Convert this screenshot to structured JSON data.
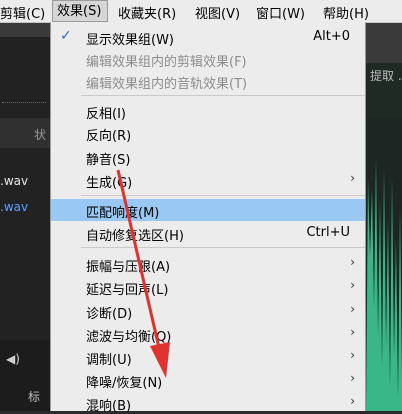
{
  "menubar": {
    "items": [
      "剪辑(C)",
      "效果(S)",
      "收藏夹(R)",
      "视图(V)",
      "窗口(W)",
      "帮助(H)"
    ],
    "active": "效果(S)"
  },
  "background": {
    "files": [
      ".wav",
      ".wav"
    ],
    "status_label": "状",
    "right_text": "提取 .w",
    "bottom_label": "标"
  },
  "effects_menu": {
    "items": [
      {
        "label": "显示效果组(W)",
        "shortcut": "Alt+0",
        "checked": true,
        "enabled": true
      },
      {
        "label": "编辑效果组内的剪辑效果(F)",
        "enabled": false
      },
      {
        "label": "编辑效果组内的音轨效果(T)",
        "enabled": false
      },
      {
        "label": "反相(I)",
        "enabled": true
      },
      {
        "label": "反向(R)",
        "enabled": true
      },
      {
        "label": "静音(S)",
        "enabled": true
      },
      {
        "label": "生成(G)",
        "submenu": true,
        "enabled": true
      },
      {
        "label": "匹配响度(M)",
        "enabled": true,
        "highlighted": true
      },
      {
        "label": "自动修复选区(H)",
        "shortcut": "Ctrl+U",
        "enabled": true
      },
      {
        "label": "振幅与压限(A)",
        "submenu": true,
        "enabled": true
      },
      {
        "label": "延迟与回声(L)",
        "submenu": true,
        "enabled": true
      },
      {
        "label": "诊断(D)",
        "submenu": true,
        "enabled": true
      },
      {
        "label": "滤波与均衡(Q)",
        "submenu": true,
        "enabled": true
      },
      {
        "label": "调制(U)",
        "submenu": true,
        "enabled": true
      },
      {
        "label": "降噪/恢复(N)",
        "submenu": true,
        "enabled": true
      },
      {
        "label": "混响(B)",
        "submenu": true,
        "enabled": true
      }
    ],
    "submenu_arrow": "›",
    "check_mark": "✓"
  },
  "colors": {
    "menu_bg": "#ececec",
    "highlight": "#99c8f4",
    "annotation_arrow": "#e0322e",
    "waveform": "#3fd19a"
  }
}
